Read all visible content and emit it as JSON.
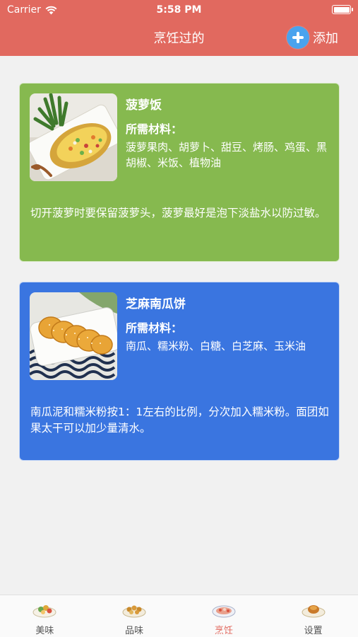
{
  "status_bar": {
    "carrier": "Carrier",
    "time": "5:58 PM"
  },
  "nav": {
    "title": "烹饪过的",
    "add_label": "添加"
  },
  "cards": [
    {
      "title": "菠萝饭",
      "ingredients_label": "所需材料：",
      "ingredients": "菠萝果肉、胡萝卜、甜豆、烤肠、鸡蛋、黑胡椒、米饭、植物油",
      "tip": "切开菠萝时要保留菠萝头，菠萝最好是泡下淡盐水以防过敏。",
      "color": "#86b94f"
    },
    {
      "title": "芝麻南瓜饼",
      "ingredients_label": "所需材料：",
      "ingredients": "南瓜、糯米粉、白糖、白芝麻、玉米油",
      "tip": "南瓜泥和糯米粉按1：1左右的比例，分次加入糯米粉。面团如果太干可以加少量清水。",
      "color": "#3a75e0"
    }
  ],
  "tabs": [
    {
      "label": "美味",
      "icon": "food-plate-icon"
    },
    {
      "label": "品味",
      "icon": "tasting-dish-icon"
    },
    {
      "label": "烹饪",
      "icon": "cooking-dish-icon",
      "active": true
    },
    {
      "label": "设置",
      "icon": "settings-dish-icon"
    }
  ],
  "colors": {
    "accent": "#e1695f",
    "add_button": "#4aa3ee"
  }
}
